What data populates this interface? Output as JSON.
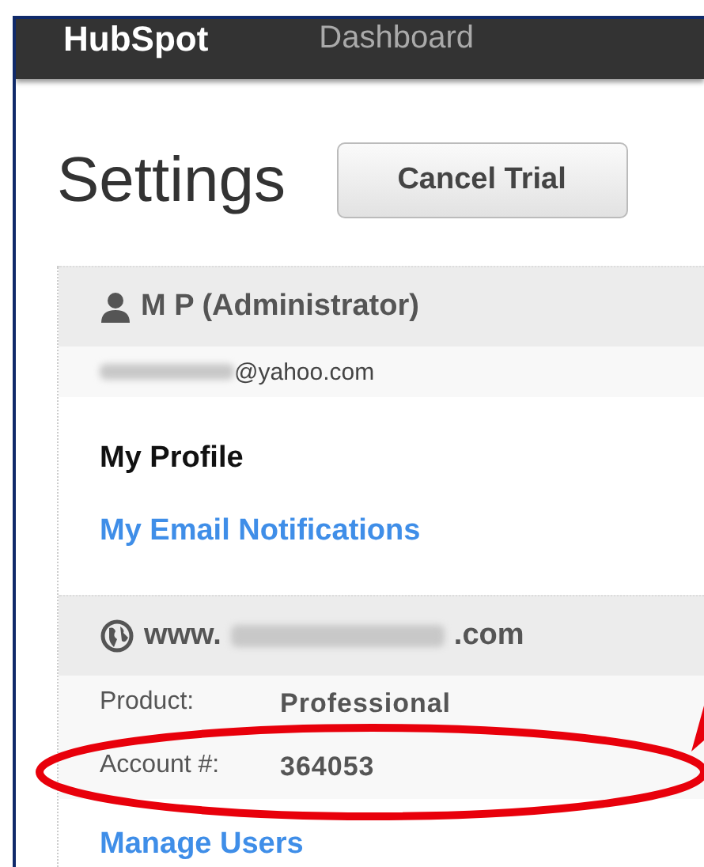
{
  "top_bar": {
    "logo": "HubSpot",
    "nav_item": "Dashboard"
  },
  "page": {
    "title": "Settings",
    "cancel_button": "Cancel Trial"
  },
  "user_section": {
    "name": "M P (Administrator)",
    "email_suffix": "@yahoo.com",
    "links": [
      {
        "label": "My Profile",
        "selected": true
      },
      {
        "label": "My Email Notifications",
        "selected": false
      }
    ]
  },
  "site_section": {
    "domain_prefix": "www.",
    "domain_suffix": ".com",
    "fields": [
      {
        "label": "Product:",
        "value": "Professional"
      },
      {
        "label": "Account #:",
        "value": "364053"
      }
    ],
    "links": [
      {
        "label": "Manage Users",
        "selected": false
      }
    ]
  }
}
